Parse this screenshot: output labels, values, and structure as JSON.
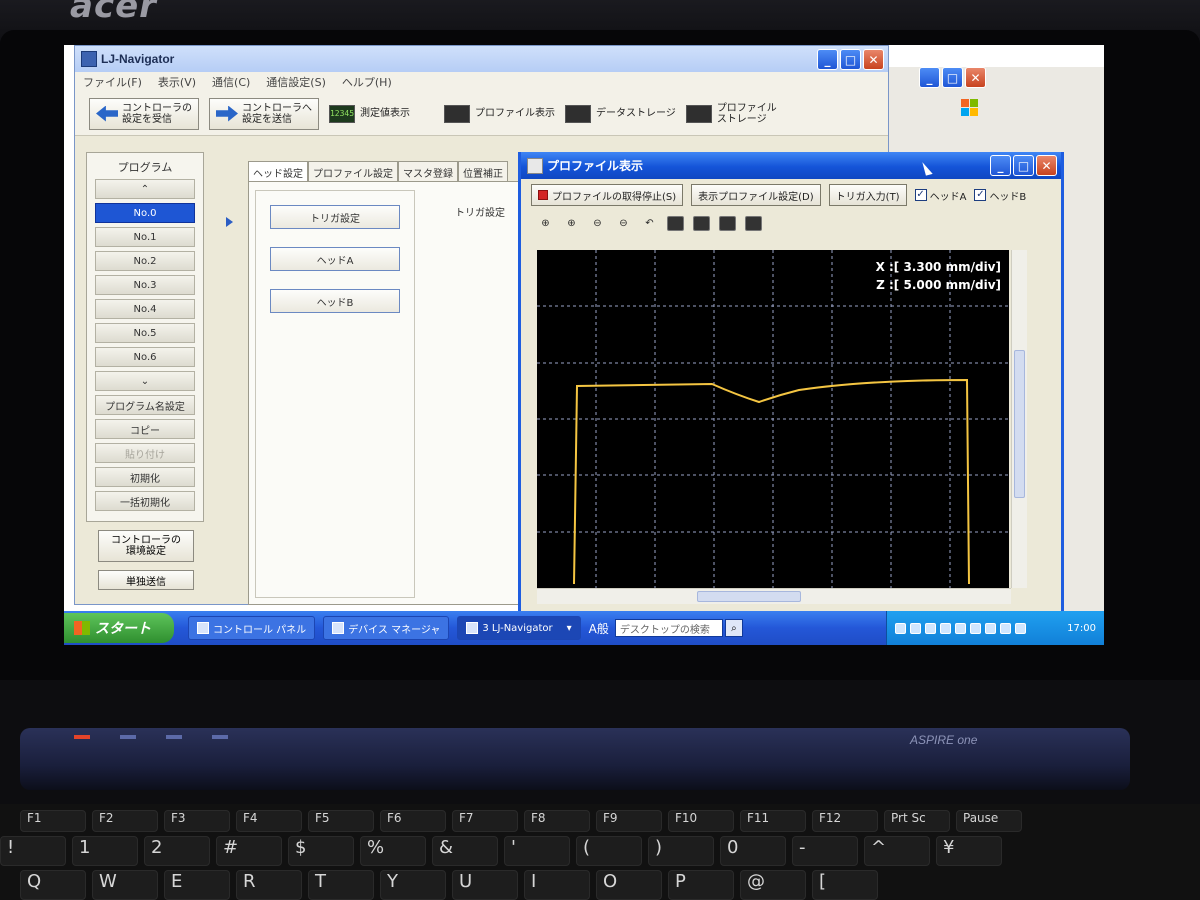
{
  "device": {
    "brand": "acer",
    "model": "ASPIRE one"
  },
  "main_window": {
    "title": "LJ-Navigator",
    "menu": [
      "ファイル(F)",
      "表示(V)",
      "通信(C)",
      "通信設定(S)",
      "ヘルプ(H)"
    ],
    "toolbar": {
      "receive_label": "コントローラの\n設定を受信",
      "send_label": "コントローラへ\n設定を送信",
      "measure_icon_text": "12345",
      "measure_label": "測定値表示",
      "profile_label": "プロファイル表示",
      "storage_label": "データストレージ",
      "profile_storage_label": "プロファイル\nストレージ"
    },
    "program_panel": {
      "title": "プログラム",
      "up_label": "⌃",
      "items": [
        "No.0",
        "No.1",
        "No.2",
        "No.3",
        "No.4",
        "No.5",
        "No.6"
      ],
      "selected_index": 0,
      "down_label": "⌄",
      "rename_label": "プログラム名設定",
      "copy_label": "コピー",
      "paste_label": "貼り付け",
      "init_label": "初期化",
      "init_all_label": "一括初期化",
      "env_label": "コントローラの\n環境設定",
      "single_send_label": "単独送信"
    },
    "tabs": [
      "ヘッド設定",
      "プロファイル設定",
      "マスタ登録",
      "位置補正"
    ],
    "head_buttons": [
      "トリガ設定",
      "ヘッドA",
      "ヘッドB"
    ],
    "trigger_section_label": "トリガ設定"
  },
  "profile_window": {
    "title": "プロファイル表示",
    "stop_label": "プロファイルの取得停止(S)",
    "display_settings_label": "表示プロファイル設定(D)",
    "trigger_input_label": "トリガ入力(T)",
    "head_a_label": "ヘッドA",
    "head_b_label": "ヘッドB",
    "head_a_checked": true,
    "head_b_checked": true,
    "scale_x": "X :[ 3.300 mm/div]",
    "scale_z": "Z :[ 5.000 mm/div]"
  },
  "taskbar": {
    "start_label": "スタート",
    "items": [
      "コントロール パネル",
      "デバイス マネージャ",
      "3 LJ-Navigator"
    ],
    "active_index": 2,
    "lang": "A般",
    "search_placeholder": "デスクトップの検索",
    "clock": "17:00"
  },
  "keyboard": {
    "fn_row": [
      "F1",
      "F2",
      "F3",
      "F4",
      "F5",
      "F6",
      "F7",
      "F8",
      "F9",
      "F10",
      "F11",
      "F12",
      "Prt Sc",
      "Pause"
    ],
    "num_row": [
      "!",
      "1",
      "2",
      "#",
      "$",
      "%",
      "&",
      "'",
      "(",
      ")",
      "0",
      "-",
      "^",
      "¥"
    ],
    "q_row": [
      "Q",
      "W",
      "E",
      "R",
      "T",
      "Y",
      "U",
      "I",
      "O",
      "P",
      "@",
      "["
    ]
  },
  "colors": {
    "xp_blue": "#1e5de0",
    "profile_line": "#f4c542",
    "grid": "#9aa4c8",
    "selected_program": "#1e56d4"
  }
}
